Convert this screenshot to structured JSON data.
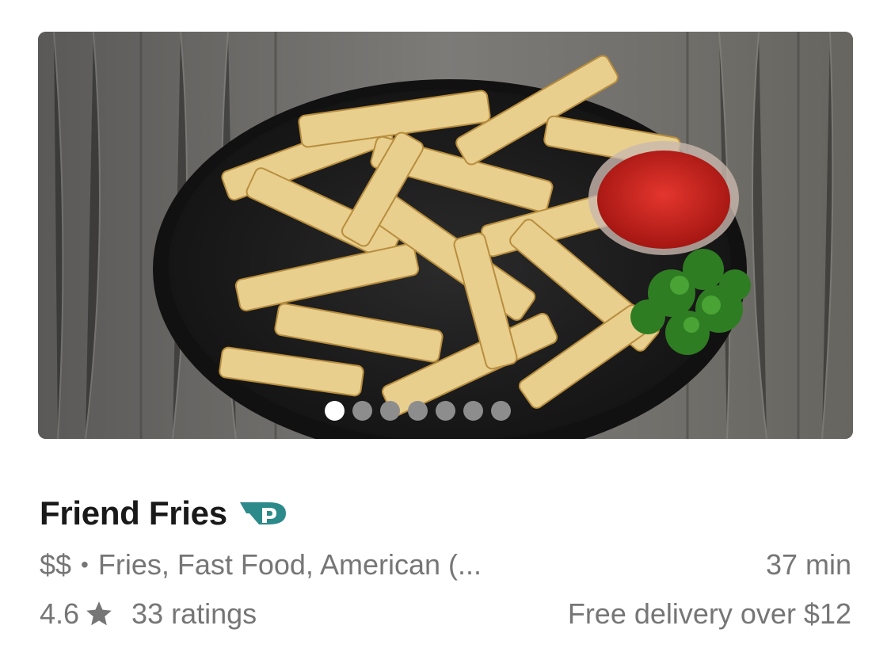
{
  "store": {
    "name": "Friend Fries",
    "badge_icon": "dashpass-icon",
    "price_range": "$$",
    "separator": "•",
    "cuisines": "Fries, Fast Food, American (...",
    "delivery_time": "37 min",
    "rating": "4.6",
    "rating_icon": "star-icon",
    "ratings_count": "33 ratings",
    "delivery_fee": "Free delivery over $12"
  },
  "carousel": {
    "image_description": "food-photo",
    "page_count": 7,
    "active_index": 0
  },
  "colors": {
    "title": "#191919",
    "secondary_text": "#767676",
    "dashpass_teal": "#2c8a8a",
    "dot_inactive": "#8d8d8d",
    "dot_active": "#ffffff"
  }
}
